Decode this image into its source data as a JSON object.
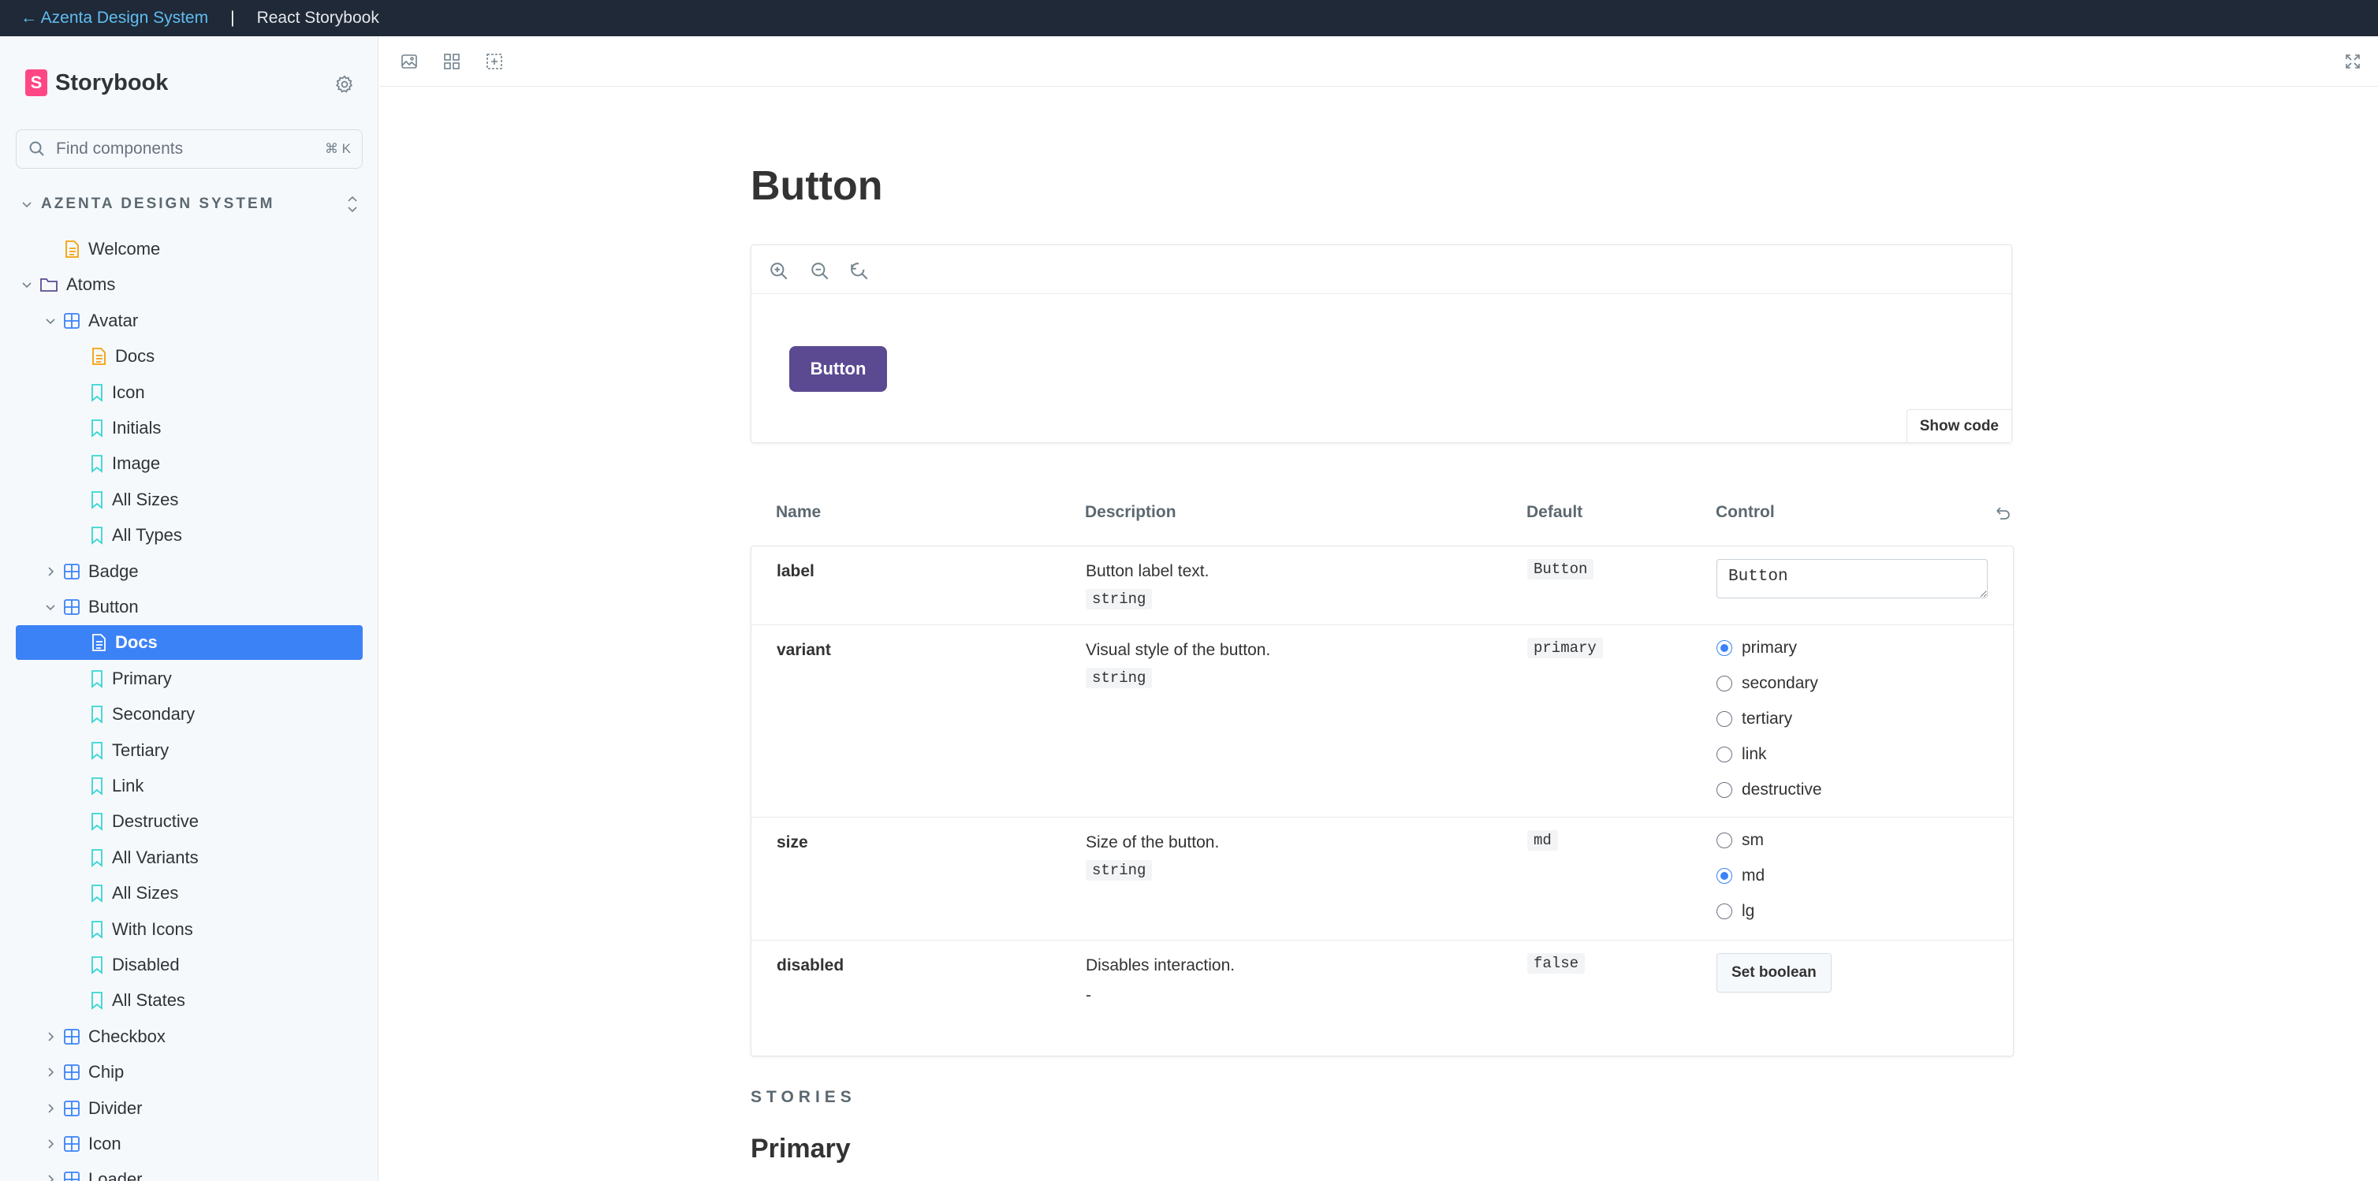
{
  "topbar": {
    "back_link": "← Azenta Design System",
    "separator": "|",
    "context": "React Storybook"
  },
  "sidebar": {
    "brand": "Storybook",
    "brand_badge": "S",
    "search_placeholder": "Find components",
    "search_shortcut": "⌘ K",
    "section_title": "AZENTA DESIGN SYSTEM",
    "items": [
      {
        "label": "Welcome",
        "icon": "doc-icon",
        "indent": 1,
        "chevron": ""
      },
      {
        "label": "Atoms",
        "icon": "folder-icon",
        "indent": 0,
        "chevron": "down"
      },
      {
        "label": "Avatar",
        "icon": "component-icon",
        "indent": 1,
        "chevron": "down"
      },
      {
        "label": "Docs",
        "icon": "doc-icon",
        "indent": 3,
        "chevron": ""
      },
      {
        "label": "Icon",
        "icon": "story-icon",
        "indent": 3,
        "chevron": ""
      },
      {
        "label": "Initials",
        "icon": "story-icon",
        "indent": 3,
        "chevron": ""
      },
      {
        "label": "Image",
        "icon": "story-icon",
        "indent": 3,
        "chevron": ""
      },
      {
        "label": "All Sizes",
        "icon": "story-icon",
        "indent": 3,
        "chevron": ""
      },
      {
        "label": "All Types",
        "icon": "story-icon",
        "indent": 3,
        "chevron": ""
      },
      {
        "label": "Badge",
        "icon": "component-icon",
        "indent": 1,
        "chevron": "right"
      },
      {
        "label": "Button",
        "icon": "component-icon",
        "indent": 1,
        "chevron": "down"
      },
      {
        "label": "Docs",
        "icon": "doc-icon",
        "indent": 3,
        "chevron": "",
        "selected": true
      },
      {
        "label": "Primary",
        "icon": "story-icon",
        "indent": 3,
        "chevron": ""
      },
      {
        "label": "Secondary",
        "icon": "story-icon",
        "indent": 3,
        "chevron": ""
      },
      {
        "label": "Tertiary",
        "icon": "story-icon",
        "indent": 3,
        "chevron": ""
      },
      {
        "label": "Link",
        "icon": "story-icon",
        "indent": 3,
        "chevron": ""
      },
      {
        "label": "Destructive",
        "icon": "story-icon",
        "indent": 3,
        "chevron": ""
      },
      {
        "label": "All Variants",
        "icon": "story-icon",
        "indent": 3,
        "chevron": ""
      },
      {
        "label": "All Sizes",
        "icon": "story-icon",
        "indent": 3,
        "chevron": ""
      },
      {
        "label": "With Icons",
        "icon": "story-icon",
        "indent": 3,
        "chevron": ""
      },
      {
        "label": "Disabled",
        "icon": "story-icon",
        "indent": 3,
        "chevron": ""
      },
      {
        "label": "All States",
        "icon": "story-icon",
        "indent": 3,
        "chevron": ""
      },
      {
        "label": "Checkbox",
        "icon": "component-icon",
        "indent": 1,
        "chevron": "right"
      },
      {
        "label": "Chip",
        "icon": "component-icon",
        "indent": 1,
        "chevron": "right"
      },
      {
        "label": "Divider",
        "icon": "component-icon",
        "indent": 1,
        "chevron": "right"
      },
      {
        "label": "Icon",
        "icon": "component-icon",
        "indent": 1,
        "chevron": "right"
      },
      {
        "label": "Loader",
        "icon": "component-icon",
        "indent": 1,
        "chevron": "right"
      }
    ]
  },
  "doc": {
    "title": "Button",
    "demo_button": "Button",
    "show_code": "Show code",
    "headers": {
      "name": "Name",
      "description": "Description",
      "default": "Default",
      "control": "Control"
    },
    "rows": [
      {
        "name": "label",
        "description": "Button label text.",
        "type": "string",
        "default": "Button",
        "control": {
          "kind": "text",
          "value": "Button"
        }
      },
      {
        "name": "variant",
        "description": "Visual style of the button.",
        "type": "string",
        "default": "primary",
        "control": {
          "kind": "radio",
          "options": [
            "primary",
            "secondary",
            "tertiary",
            "link",
            "destructive"
          ],
          "selected": "primary"
        }
      },
      {
        "name": "size",
        "description": "Size of the button.",
        "type": "string",
        "default": "md",
        "control": {
          "kind": "radio",
          "options": [
            "sm",
            "md",
            "lg"
          ],
          "selected": "md"
        }
      },
      {
        "name": "disabled",
        "description": "Disables interaction.",
        "type": "-",
        "default": "false",
        "control": {
          "kind": "button",
          "label": "Set boolean"
        }
      }
    ],
    "stories_heading": "STORIES",
    "story_title": "Primary"
  },
  "colors": {
    "topbar_bg": "#1f2937",
    "accent": "#3b82f6",
    "brand_pink": "#ff4785",
    "button_purple": "#5b4a92",
    "story_icon": "#37d5d3",
    "doc_icon": "#f59e0b",
    "component_icon": "#3b82f6"
  }
}
